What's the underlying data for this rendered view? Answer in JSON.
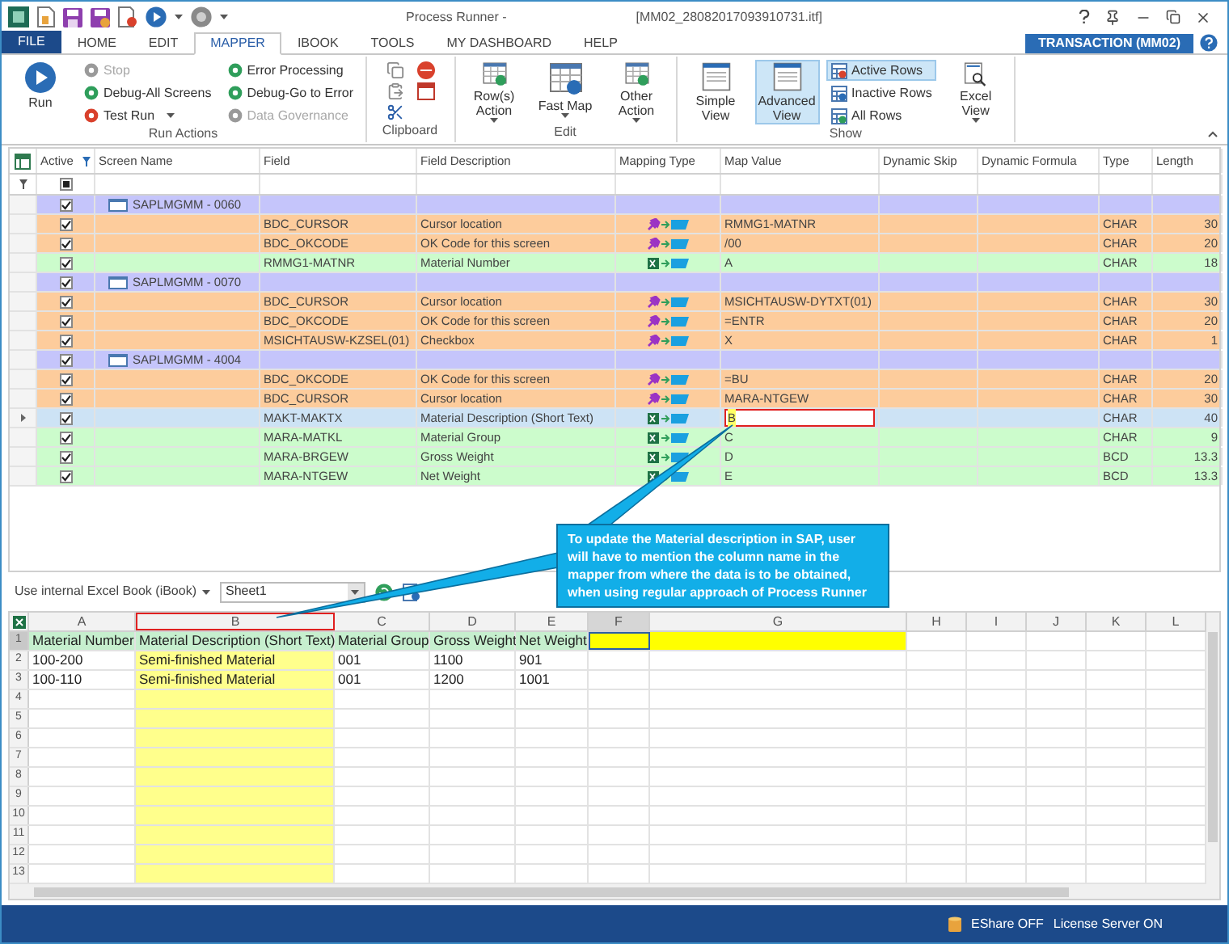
{
  "window": {
    "title": "Process Runner -",
    "file": "[MM02_28082017093910731.itf]"
  },
  "tabs": [
    {
      "label": "FILE",
      "kind": "file",
      "selected": false
    },
    {
      "label": "HOME",
      "kind": "tab",
      "selected": false
    },
    {
      "label": "EDIT",
      "kind": "tab",
      "selected": false
    },
    {
      "label": "MAPPER",
      "kind": "tab",
      "selected": true
    },
    {
      "label": "IBOOK",
      "kind": "tab",
      "selected": false
    },
    {
      "label": "TOOLS",
      "kind": "tab",
      "selected": false
    },
    {
      "label": "MY DASHBOARD",
      "kind": "tab",
      "selected": false
    },
    {
      "label": "HELP",
      "kind": "tab",
      "selected": false
    }
  ],
  "transaction": "TRANSACTION (MM02)",
  "ribbon": [
    {
      "label": "Run Actions",
      "buttons": [
        {
          "label": "Run",
          "kind": "large",
          "disabled": false,
          "dropdown": false,
          "selected": false
        },
        {
          "label": "Stop",
          "kind": "small",
          "disabled": true,
          "dropdown": false,
          "selected": false
        },
        {
          "label": "Debug-All Screens",
          "kind": "small",
          "disabled": false,
          "dropdown": false,
          "selected": false
        },
        {
          "label": "Test Run",
          "kind": "small",
          "disabled": false,
          "dropdown": true,
          "selected": false
        },
        {
          "label": "Error Processing",
          "kind": "small",
          "disabled": false,
          "dropdown": false,
          "selected": false
        },
        {
          "label": "Debug-Go to Error",
          "kind": "small",
          "disabled": false,
          "dropdown": false,
          "selected": false
        },
        {
          "label": "Data Governance",
          "kind": "small",
          "disabled": true,
          "dropdown": false,
          "selected": false
        }
      ]
    },
    {
      "label": "Clipboard"
    },
    {
      "label": "Edit",
      "buttons": [
        {
          "label": "Row(s) Action",
          "kind": "large",
          "disabled": false,
          "dropdown": true,
          "selected": false
        },
        {
          "label": "Fast Map",
          "kind": "large",
          "disabled": false,
          "dropdown": true,
          "selected": false
        },
        {
          "label": "Other Action",
          "kind": "large",
          "disabled": false,
          "dropdown": true,
          "selected": false
        }
      ]
    },
    {
      "label": "Show",
      "buttons": [
        {
          "label": "Simple View",
          "kind": "large",
          "disabled": false,
          "dropdown": false,
          "selected": false
        },
        {
          "label": "Advanced View",
          "kind": "large",
          "disabled": false,
          "dropdown": false,
          "selected": true
        },
        {
          "label": "Active Rows",
          "kind": "small",
          "disabled": false,
          "dropdown": false,
          "selected": true
        },
        {
          "label": "Inactive Rows",
          "kind": "small",
          "disabled": false,
          "dropdown": false,
          "selected": false
        },
        {
          "label": "All Rows",
          "kind": "small",
          "disabled": false,
          "dropdown": false,
          "selected": false
        },
        {
          "label": "Excel View",
          "kind": "large",
          "disabled": false,
          "dropdown": true,
          "selected": false
        }
      ]
    }
  ],
  "grid": {
    "filter_indeterminate": true,
    "columns": [
      "Active",
      "Screen Name",
      "Field",
      "Field Description",
      "Mapping Type",
      "Map Value",
      "Dynamic Skip",
      "Dynamic Formula",
      "Type",
      "Length"
    ],
    "rows": [
      {
        "kind": "screen",
        "active": true,
        "selected": false,
        "screen": "SAPLMGMM - 0060"
      },
      {
        "kind": "constant",
        "active": true,
        "selected": false,
        "field": "BDC_CURSOR",
        "description": "Cursor location",
        "value": "RMMG1-MATNR",
        "type": "CHAR",
        "length": "30"
      },
      {
        "kind": "constant",
        "active": true,
        "selected": false,
        "field": "BDC_OKCODE",
        "description": "OK Code for this screen",
        "value": "/00",
        "type": "CHAR",
        "length": "20"
      },
      {
        "kind": "excel",
        "active": true,
        "selected": false,
        "field": "RMMG1-MATNR",
        "description": "Material Number",
        "value": "A",
        "type": "CHAR",
        "length": "18"
      },
      {
        "kind": "screen",
        "active": true,
        "selected": false,
        "screen": "SAPLMGMM - 0070"
      },
      {
        "kind": "constant",
        "active": true,
        "selected": false,
        "field": "BDC_CURSOR",
        "description": "Cursor location",
        "value": "MSICHTAUSW-DYTXT(01)",
        "type": "CHAR",
        "length": "30"
      },
      {
        "kind": "constant",
        "active": true,
        "selected": false,
        "field": "BDC_OKCODE",
        "description": "OK Code for this screen",
        "value": "=ENTR",
        "type": "CHAR",
        "length": "20"
      },
      {
        "kind": "constant",
        "active": true,
        "selected": false,
        "field": "MSICHTAUSW-KZSEL(01)",
        "description": "Checkbox",
        "value": "X",
        "type": "CHAR",
        "length": "1"
      },
      {
        "kind": "screen",
        "active": true,
        "selected": false,
        "screen": "SAPLMGMM - 4004"
      },
      {
        "kind": "constant",
        "active": true,
        "selected": false,
        "field": "BDC_OKCODE",
        "description": "OK Code for this screen",
        "value": "=BU",
        "type": "CHAR",
        "length": "20"
      },
      {
        "kind": "constant",
        "active": true,
        "selected": false,
        "field": "BDC_CURSOR",
        "description": "Cursor location",
        "value": "MARA-NTGEW",
        "type": "CHAR",
        "length": "30"
      },
      {
        "kind": "excel",
        "active": true,
        "selected": true,
        "field": "MAKT-MAKTX",
        "description": "Material Description (Short Text)",
        "value": "B",
        "type": "CHAR",
        "length": "40"
      },
      {
        "kind": "excel",
        "active": true,
        "selected": false,
        "field": "MARA-MATKL",
        "description": "Material Group",
        "value": "C",
        "type": "CHAR",
        "length": "9"
      },
      {
        "kind": "excel",
        "active": true,
        "selected": false,
        "field": "MARA-BRGEW",
        "description": "Gross Weight",
        "value": "D",
        "type": "BCD",
        "length": "13.3"
      },
      {
        "kind": "excel",
        "active": true,
        "selected": false,
        "field": "MARA-NTGEW",
        "description": "Net Weight",
        "value": "E",
        "type": "BCD",
        "length": "13.3"
      }
    ]
  },
  "callout": "To update the Material description in SAP, user will have to mention the column name in the mapper from where the data is to be obtained, when using regular approach of Process Runner",
  "excel": {
    "source": "Use internal Excel Book (iBook)",
    "sheet": "Sheet1",
    "columns": [
      {
        "label": "A",
        "selected": false,
        "outlined": false,
        "highlighted": false
      },
      {
        "label": "B",
        "selected": false,
        "outlined": true,
        "highlighted": true
      },
      {
        "label": "C",
        "selected": false,
        "outlined": false,
        "highlighted": false
      },
      {
        "label": "D",
        "selected": false,
        "outlined": false,
        "highlighted": false
      },
      {
        "label": "E",
        "selected": false,
        "outlined": false,
        "highlighted": false
      },
      {
        "label": "F",
        "selected": true,
        "outlined": false,
        "highlighted": false
      },
      {
        "label": "G",
        "selected": false,
        "outlined": false,
        "highlighted": false
      },
      {
        "label": "H",
        "selected": false,
        "outlined": false,
        "highlighted": false
      },
      {
        "label": "I",
        "selected": false,
        "outlined": false,
        "highlighted": false
      },
      {
        "label": "J",
        "selected": false,
        "outlined": false,
        "highlighted": false
      },
      {
        "label": "K",
        "selected": false,
        "outlined": false,
        "highlighted": false
      },
      {
        "label": "L",
        "selected": false,
        "outlined": false,
        "highlighted": false
      }
    ],
    "rows": [
      {
        "number": "1",
        "selected": true,
        "cells": [
          {
            "text": "Material Number",
            "color": "#c6efce"
          },
          {
            "text": "Material Description (Short Text)",
            "color": "#c6efce"
          },
          {
            "text": "Material Group",
            "color": "#c6efce"
          },
          {
            "text": "Gross Weight",
            "color": "#c6efce"
          },
          {
            "text": "Net Weight",
            "color": "#c6efce"
          },
          {
            "color": "#ffff00"
          },
          {
            "color": "#ffff00"
          }
        ]
      },
      {
        "number": "2",
        "selected": false,
        "cells": [
          {
            "text": "100-200"
          },
          {
            "text": "Semi-finished Material"
          },
          {
            "text": "001"
          },
          {
            "text": "1100"
          },
          {
            "text": "901"
          }
        ]
      },
      {
        "number": "3",
        "selected": false,
        "cells": [
          {
            "text": "100-110"
          },
          {
            "text": "Semi-finished Material"
          },
          {
            "text": "001"
          },
          {
            "text": "1200"
          },
          {
            "text": "1001"
          }
        ]
      },
      {
        "number": "4",
        "selected": false
      },
      {
        "number": "5",
        "selected": false
      },
      {
        "number": "6",
        "selected": false
      },
      {
        "number": "7",
        "selected": false
      },
      {
        "number": "8",
        "selected": false
      },
      {
        "number": "9",
        "selected": false
      },
      {
        "number": "10",
        "selected": false
      },
      {
        "number": "11",
        "selected": false
      },
      {
        "number": "12",
        "selected": false
      },
      {
        "number": "13",
        "selected": false
      }
    ]
  },
  "status_bar": [
    "EShare OFF",
    "License Server ON"
  ]
}
